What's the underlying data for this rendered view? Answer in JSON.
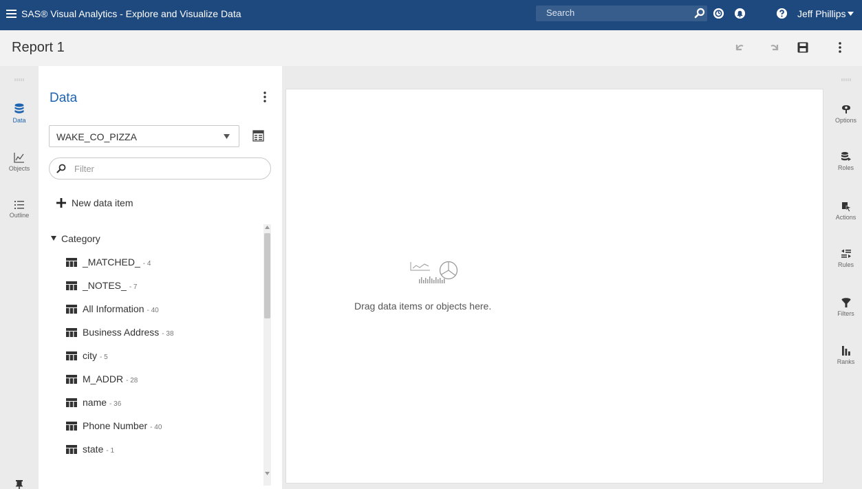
{
  "topbar": {
    "app_title": "SAS® Visual Analytics - Explore and Visualize Data",
    "search_placeholder": "Search",
    "user_name": "Jeff Phillips"
  },
  "report": {
    "title": "Report 1"
  },
  "left_rail": {
    "items": [
      {
        "label": "Data",
        "icon": "database-icon",
        "active": true
      },
      {
        "label": "Objects",
        "icon": "chart-icon",
        "active": false
      },
      {
        "label": "Outline",
        "icon": "outline-icon",
        "active": false
      }
    ]
  },
  "data_pane": {
    "title": "Data",
    "data_source": "WAKE_CO_PIZZA",
    "filter_placeholder": "Filter",
    "new_item_label": "New data item",
    "category_label": "Category",
    "items": [
      {
        "name": "_MATCHED_",
        "count": "4"
      },
      {
        "name": "_NOTES_",
        "count": "7"
      },
      {
        "name": "All Information",
        "count": "40"
      },
      {
        "name": "Business Address",
        "count": "38"
      },
      {
        "name": "city",
        "count": "5"
      },
      {
        "name": "M_ADDR",
        "count": "28"
      },
      {
        "name": "name",
        "count": "36"
      },
      {
        "name": "Phone Number",
        "count": "40"
      },
      {
        "name": "state",
        "count": "1"
      }
    ]
  },
  "canvas": {
    "empty_message": "Drag data items or objects here."
  },
  "right_rail": {
    "items": [
      {
        "label": "Options",
        "icon": "options-icon"
      },
      {
        "label": "Roles",
        "icon": "roles-icon"
      },
      {
        "label": "Actions",
        "icon": "actions-icon"
      },
      {
        "label": "Rules",
        "icon": "rules-icon"
      },
      {
        "label": "Filters",
        "icon": "filter-icon"
      },
      {
        "label": "Ranks",
        "icon": "ranks-icon"
      }
    ]
  },
  "colors": {
    "topbar": "#1e497f",
    "accent": "#1e63b0",
    "panel": "#ffffff",
    "rail": "#ebebeb"
  }
}
